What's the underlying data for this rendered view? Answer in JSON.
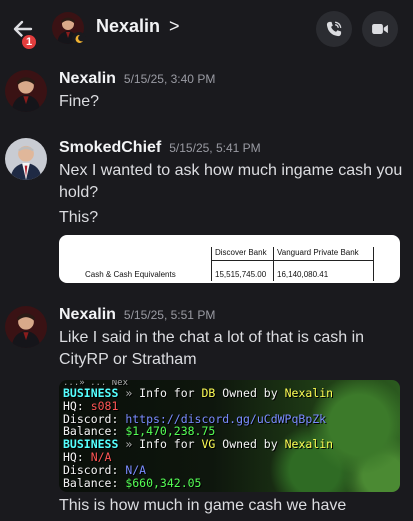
{
  "header": {
    "title": "Nexalin",
    "chevron": ">",
    "unread_count": "1"
  },
  "messages": [
    {
      "author": "Nexalin",
      "timestamp": "5/15/25, 3:40 PM",
      "lines": [
        "Fine?"
      ]
    },
    {
      "author": "SmokedChief",
      "timestamp": "5/15/25, 5:41 PM",
      "lines": [
        "Nex I wanted to ask how much ingame cash you hold?",
        "This?"
      ],
      "table": {
        "headers": [
          "",
          "Discover Bank",
          "Vanguard Private Bank"
        ],
        "row": [
          "Cash & Cash Equivalents",
          "15,515,745.00",
          "16,140,080.41"
        ]
      }
    },
    {
      "author": "Nexalin",
      "timestamp": "5/15/25, 5:51 PM",
      "lines": [
        "Like I said in the chat a lot of that is cash in CityRP or Stratham",
        "This is how much in game cash we have"
      ],
      "game_chat": {
        "top_fragment": "...»  ... Nex",
        "block1": {
          "tag": "BUSINESS",
          "sep": " » ",
          "info": "Info for ",
          "name": "DB",
          "owned": " Owned by ",
          "owner": "Nexalin",
          "hq_label": "HQ: ",
          "hq_value": "s081",
          "discord_label": "Discord: ",
          "discord_value": "https://discord.gg/uCdWPqBpZk",
          "balance_label": "Balance: ",
          "balance_value": "$1,470,238.75"
        },
        "block2": {
          "tag": "BUSINESS",
          "sep": " » ",
          "info": "Info for ",
          "name": "VG",
          "owned": " Owned by ",
          "owner": "Nexalin",
          "hq_label": "HQ: ",
          "hq_value": "N/A",
          "discord_label": "Discord: ",
          "discord_value": "N/A",
          "balance_label": "Balance: ",
          "balance_value": "$660,342.05"
        }
      }
    }
  ]
}
